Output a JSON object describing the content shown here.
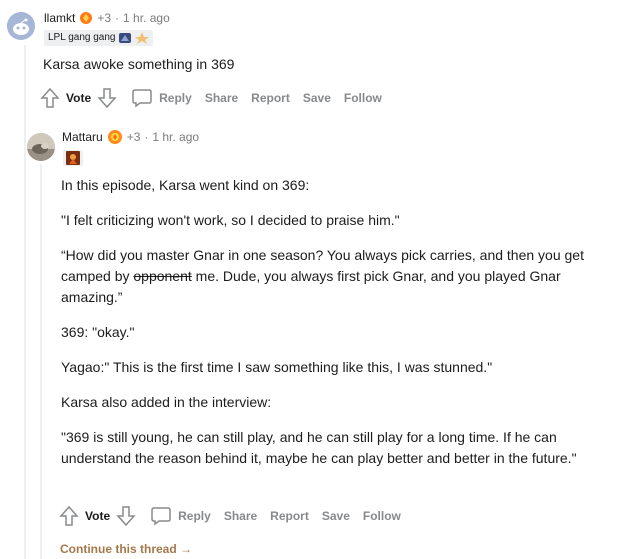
{
  "comment1": {
    "username": "llamkt",
    "karma": "+3",
    "separator": "·",
    "time": "1 hr. ago",
    "flair": "LPL gang gang",
    "body": "Karsa awoke something in 369",
    "actions": {
      "vote": "Vote",
      "reply": "Reply",
      "share": "Share",
      "report": "Report",
      "save": "Save",
      "follow": "Follow"
    }
  },
  "comment2": {
    "username": "Mattaru",
    "karma": "+3",
    "separator": "·",
    "time": "1 hr. ago",
    "paragraphs": {
      "p1": "In this episode, Karsa went kind on 369:",
      "p2": "\"I felt criticizing won't work, so I decided to praise him.\"",
      "p3a": "“How did you master Gnar in one season? You always pick carries, and then you get camped by ",
      "p3_strike": "opponent",
      "p3b": " me. Dude, you always first pick Gnar, and you played Gnar amazing.”",
      "p4": "369: \"okay.\"",
      "p5": "Yagao:\" This is the first time I saw something like this, I was stunned.\"",
      "p6": "Karsa also added in the interview:",
      "p7": "\"369 is still young, he can still play, and he can still play for a long time. If he can understand the reason behind it, maybe he can play better and better in the future.\""
    },
    "actions": {
      "vote": "Vote",
      "reply": "Reply",
      "share": "Share",
      "report": "Report",
      "save": "Save",
      "follow": "Follow"
    }
  },
  "continue_thread": "Continue this thread",
  "continue_arrow": "→",
  "icons": [
    "snoo-avatar",
    "award-icon",
    "flair-emoji-icon",
    "upvote-icon",
    "downvote-icon",
    "comment-icon",
    "arrow-right-icon"
  ]
}
